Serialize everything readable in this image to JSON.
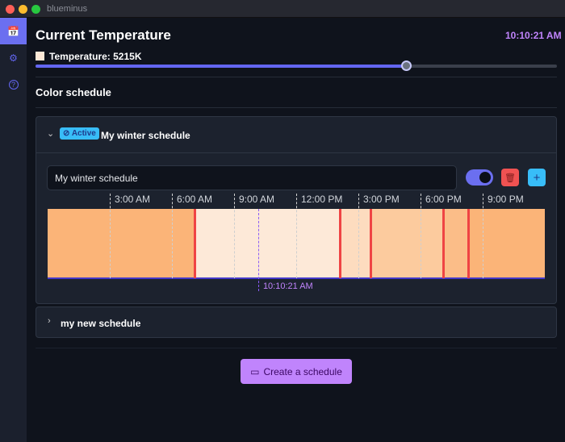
{
  "window": {
    "title": "blueminus"
  },
  "sidebar": {
    "items": [
      {
        "icon": "calendar-clock-icon",
        "active": true
      },
      {
        "icon": "gear-icon"
      },
      {
        "icon": "help-circle-icon"
      }
    ]
  },
  "header": {
    "title": "Current Temperature",
    "clock": "10:10:21 AM",
    "temperature_label": "Temperature: 5215K",
    "swatch_color": "#fde8d6",
    "slider_fraction": 0.71
  },
  "section": {
    "title": "Color schedule"
  },
  "schedules": [
    {
      "name": "My winter schedule",
      "badge": "Active",
      "expanded": true,
      "name_input": "My winter schedule",
      "enabled": true,
      "ticks": [
        "3:00 AM",
        "6:00 AM",
        "9:00 AM",
        "12:00 PM",
        "3:00 PM",
        "6:00 PM",
        "9:00 PM"
      ],
      "current_time": "10:10:21 AM",
      "segments": [
        {
          "color": "#fbb478"
        },
        {
          "color": "#fde9d8"
        },
        {
          "color": "#fddcbf"
        },
        {
          "color": "#fccb9e"
        },
        {
          "color": "#fbbd88"
        },
        {
          "color": "#fbb478"
        }
      ]
    },
    {
      "name": "my new schedule",
      "expanded": false
    }
  ],
  "create_button": "Create a schedule",
  "colors": {
    "accent": "#6366f1",
    "purple": "#c084fc",
    "danger": "#f05252",
    "info": "#38bdf8"
  }
}
